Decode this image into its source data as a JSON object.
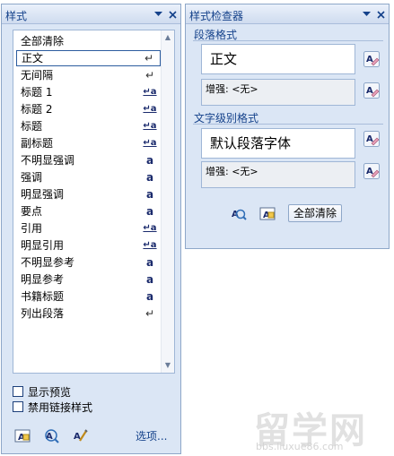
{
  "styles_pane": {
    "title": "样式",
    "items": [
      {
        "label": "全部清除",
        "icon": ""
      },
      {
        "label": "正文",
        "icon": "↵"
      },
      {
        "label": "无间隔",
        "icon": "↵"
      },
      {
        "label": "标题 1",
        "icon": "↵a"
      },
      {
        "label": "标题 2",
        "icon": "↵a"
      },
      {
        "label": "标题",
        "icon": "↵a"
      },
      {
        "label": "副标题",
        "icon": "↵a"
      },
      {
        "label": "不明显强调",
        "icon": "a"
      },
      {
        "label": "强调",
        "icon": "a"
      },
      {
        "label": "明显强调",
        "icon": "a"
      },
      {
        "label": "要点",
        "icon": "a"
      },
      {
        "label": "引用",
        "icon": "↵a"
      },
      {
        "label": "明显引用",
        "icon": "↵a"
      },
      {
        "label": "不明显参考",
        "icon": "a"
      },
      {
        "label": "明显参考",
        "icon": "a"
      },
      {
        "label": "书籍标题",
        "icon": "a"
      },
      {
        "label": "列出段落",
        "icon": "↵"
      }
    ],
    "selected_index": 1,
    "show_preview_label": "显示预览",
    "disable_linked_label": "禁用链接样式",
    "options_label": "选项..."
  },
  "inspector": {
    "title": "样式检查器",
    "paragraph_section": "段落格式",
    "paragraph_value": "正文",
    "paragraph_plus": "增强: <无>",
    "text_section": "文字级别格式",
    "text_value": "默认段落字体",
    "text_plus": "增强: <无>",
    "clear_all_label": "全部清除"
  },
  "watermark": {
    "main": "留学网",
    "sub": "bbs.liuxue86.com"
  },
  "colors": {
    "pane_bg": "#dbe6f5",
    "title_text": "#15428b",
    "border": "#8ea7c8"
  }
}
